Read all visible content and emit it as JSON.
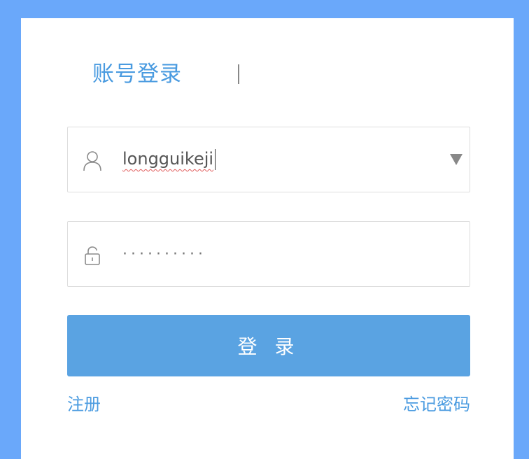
{
  "tabs": {
    "account_login": "账号登录"
  },
  "username": {
    "value": "longguikeji",
    "icon": "user-icon"
  },
  "password": {
    "masked_value": "··········",
    "icon": "lock-icon"
  },
  "login_button": {
    "label": "登 录"
  },
  "links": {
    "register": "注册",
    "forgot_password": "忘记密码"
  },
  "colors": {
    "background": "#6aa8fa",
    "accent": "#4a9be0",
    "button": "#5aa3e2"
  }
}
